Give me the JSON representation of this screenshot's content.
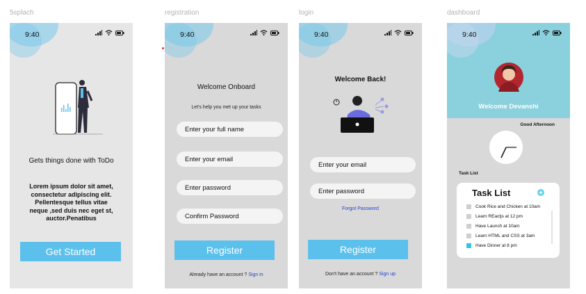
{
  "frames": {
    "splash": "5splach",
    "registration": "registration",
    "login": "login",
    "dashboard": "dashboard"
  },
  "status_time": "9:40",
  "splash": {
    "headline": "Gets things done with ToDo",
    "body_lines": [
      "Lorem ipsum dolor sit amet,",
      "consectetur adipiscing elit.",
      "Pellentesque tellus vitae",
      "neque ,sed duis nec eget st,",
      "auctor.Penatibus"
    ],
    "cta": "Get Started"
  },
  "registration": {
    "title": "Welcome Onboard",
    "subtitle": "Let's help you met up your tasks",
    "fields": [
      "Enter your full name",
      "Enter your email",
      "Enter password",
      "Confirm Password"
    ],
    "button": "Register",
    "footer_text": "Already have an account ?",
    "footer_link": "Sign in"
  },
  "login": {
    "title": "Welcome Back!",
    "fields": [
      "Enter your email",
      "Enter password"
    ],
    "forgot": "Forgot Password",
    "button": "Register",
    "footer_text": "Don't have an account ?",
    "footer_link": "Sign up"
  },
  "dashboard": {
    "welcome": "Welcome Devanshi",
    "greeting": "Good Afternoon",
    "section_label": "Task List",
    "card_title": "Task List",
    "tasks": [
      {
        "text": "Cook Rice and Chicken at 10am",
        "done": false
      },
      {
        "text": "Learn REactjs at 12 pm",
        "done": false
      },
      {
        "text": "Have Launch at 10am",
        "done": false
      },
      {
        "text": "Learn HTML and CSS at 3am",
        "done": false
      },
      {
        "text": "Have Dinner at 8 pm",
        "done": true
      }
    ]
  },
  "colors": {
    "accent": "#5bc0ec",
    "dashboard_header": "#8ad0dd",
    "link": "#2244cc"
  }
}
